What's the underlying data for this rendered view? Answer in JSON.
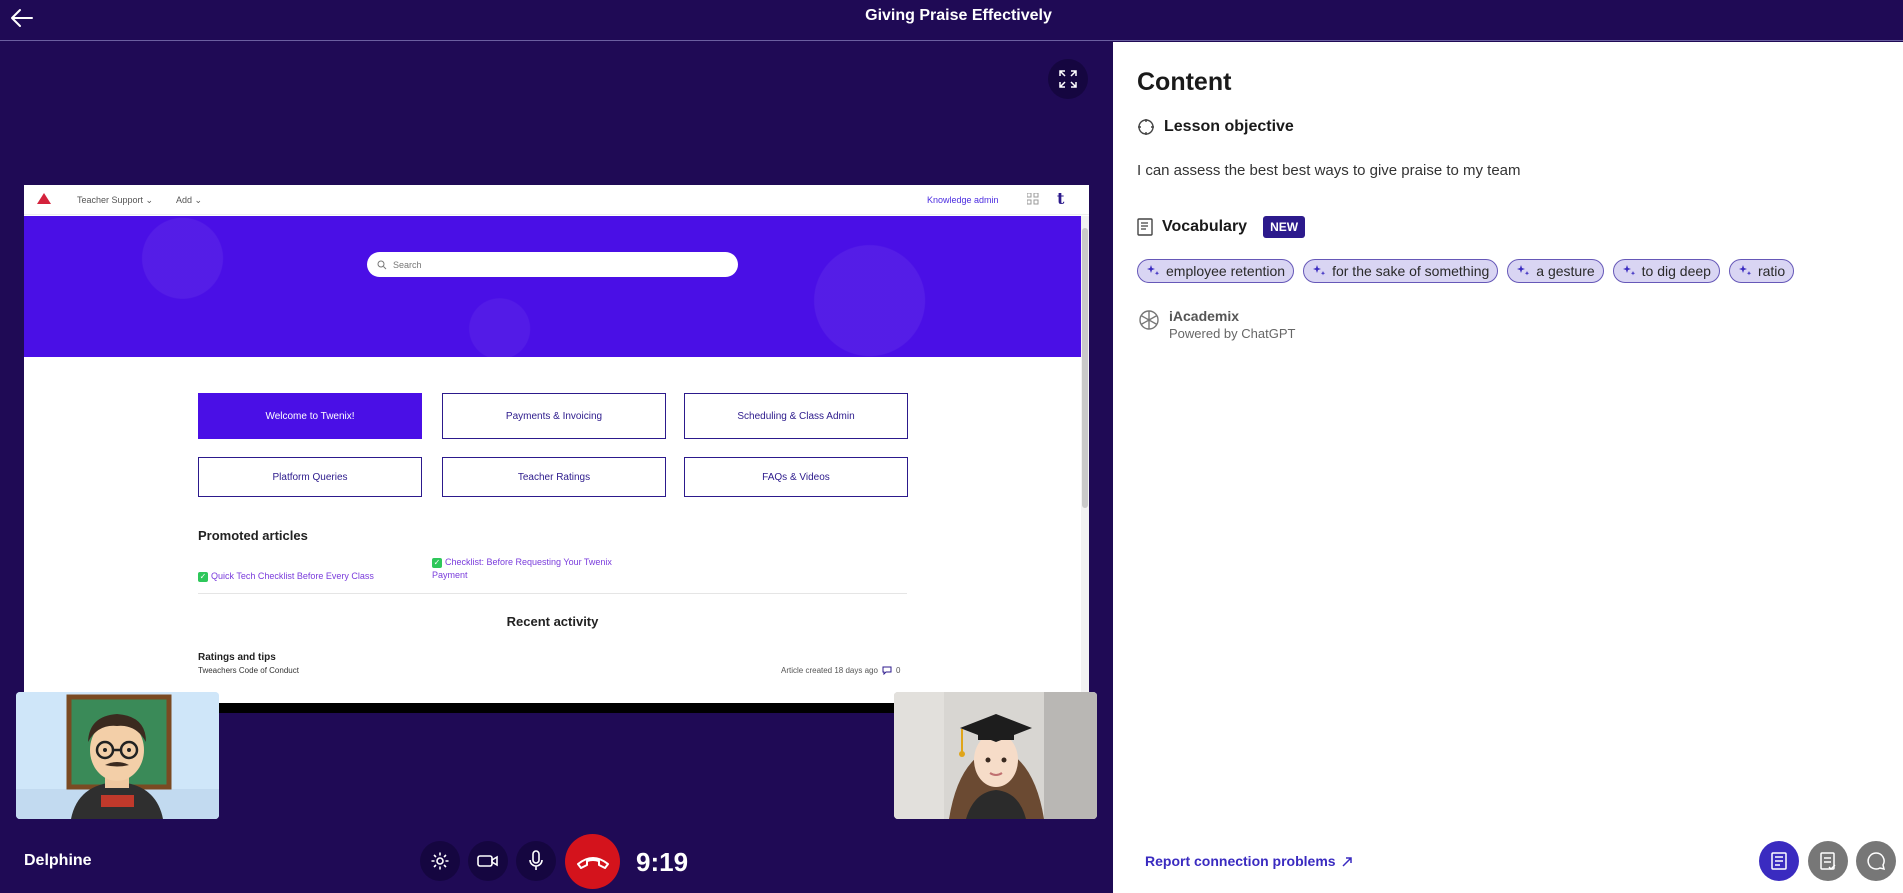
{
  "header": {
    "title": "Giving Praise Effectively"
  },
  "shared_screen": {
    "nav": {
      "menu1": "Teacher Support",
      "menu2": "Add",
      "admin_link": "Knowledge admin"
    },
    "search_placeholder": "Search",
    "categories": [
      {
        "label": "Welcome to Twenix!"
      },
      {
        "label": "Payments & Invoicing"
      },
      {
        "label": "Scheduling & Class Admin"
      },
      {
        "label": "Platform Queries"
      },
      {
        "label": "Teacher Ratings"
      },
      {
        "label": "FAQs & Videos"
      }
    ],
    "promoted_title": "Promoted articles",
    "promoted": [
      {
        "label": "Quick Tech Checklist Before Every Class"
      },
      {
        "label": "Checklist: Before Requesting Your Twenix Payment"
      }
    ],
    "recent_title": "Recent activity",
    "recent_item": {
      "section": "Ratings and tips",
      "article": "Tweachers Code of Conduct",
      "meta": "Article created 18 days ago",
      "comments": "0"
    }
  },
  "call": {
    "user_name": "Delphine",
    "timer": "9:19"
  },
  "panel": {
    "title": "Content",
    "objective_heading": "Lesson objective",
    "objective_text": "I can assess the best best ways to give praise to my team",
    "vocabulary_heading": "Vocabulary",
    "new_badge": "NEW",
    "vocabulary": [
      "employee retention",
      "for the sake of something",
      "a gesture",
      "to dig deep",
      "ratio"
    ],
    "ai_name": "iAcademix",
    "ai_powered": "Powered by ChatGPT",
    "report_link": "Report connection problems"
  },
  "colors": {
    "brand_dark": "#1f0a55",
    "accent": "#3a2bc0",
    "hangup": "#d4131c",
    "kb_primary": "#4a0fe6"
  },
  "icons": [
    "back-arrow-icon",
    "fullscreen-icon",
    "settings-icon",
    "camera-icon",
    "microphone-icon",
    "phone-hangup-icon",
    "target-icon",
    "book-icon",
    "sparkle-icon",
    "openai-logo-icon",
    "external-link-icon",
    "notes-icon",
    "checklist-icon",
    "chat-icon"
  ]
}
